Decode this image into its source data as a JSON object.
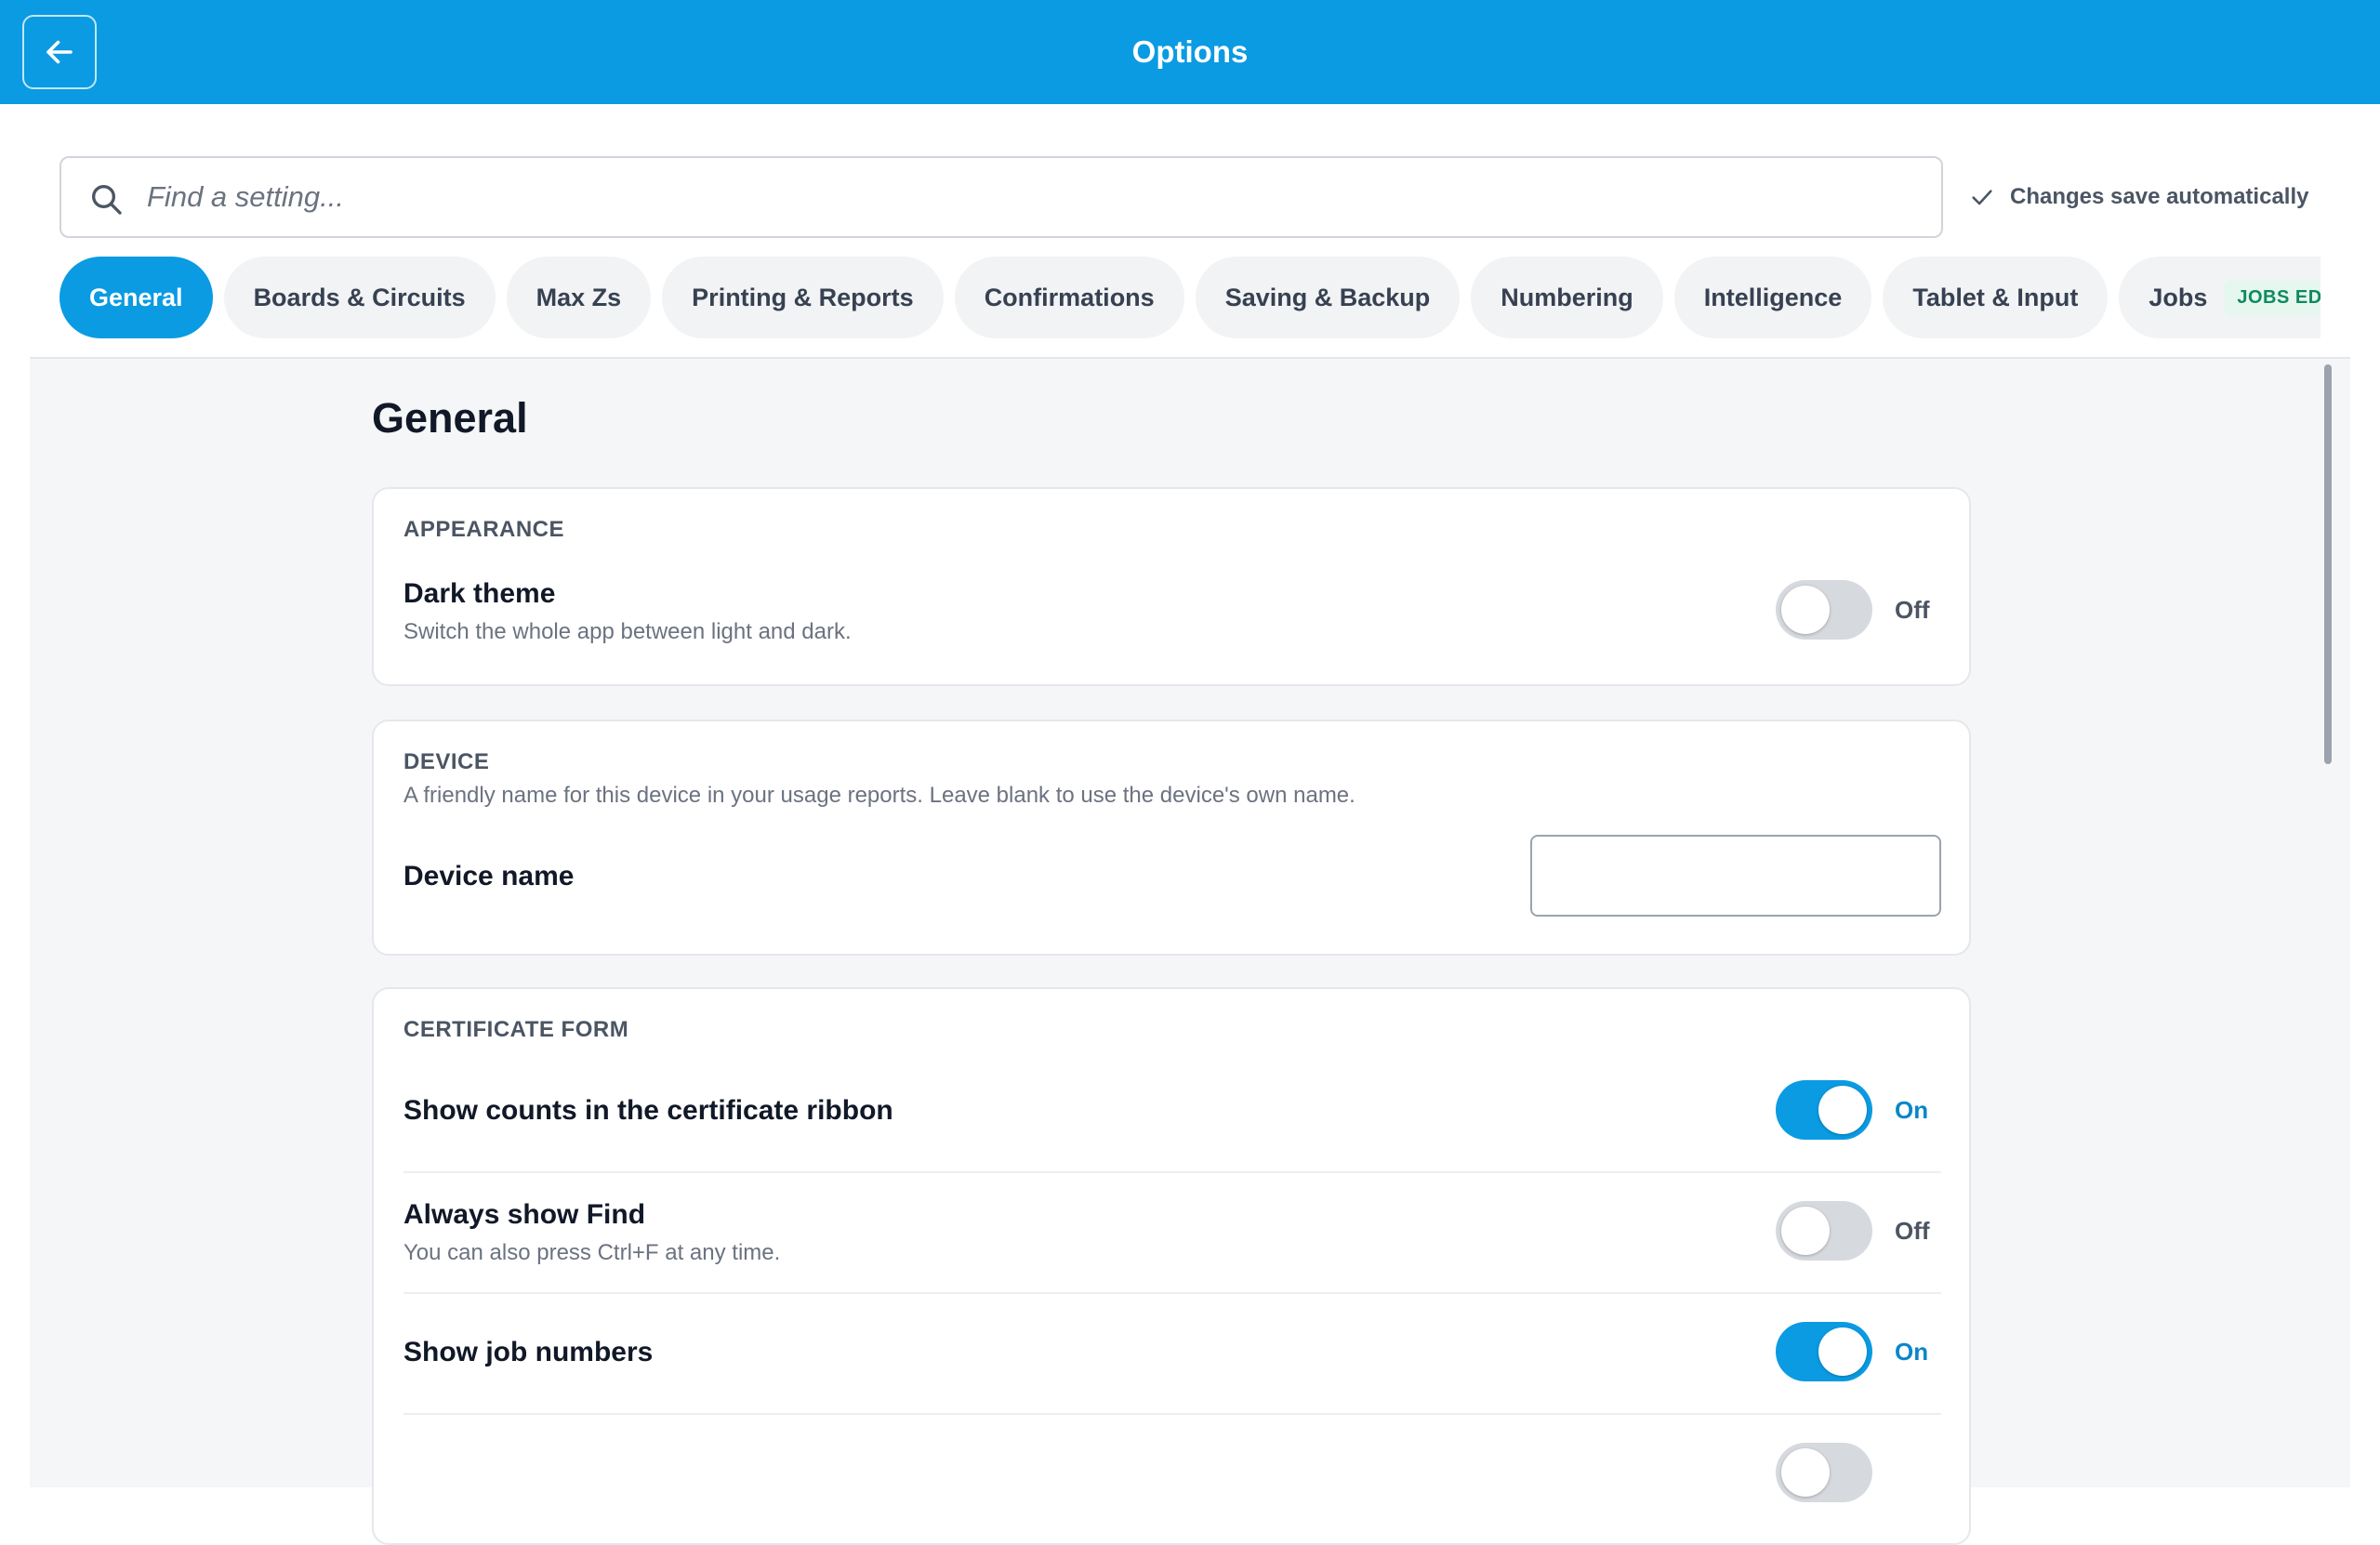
{
  "header": {
    "title": "Options",
    "back_icon": "arrow-left-icon"
  },
  "search": {
    "placeholder": "Find a setting...",
    "value": "",
    "icon": "search-icon"
  },
  "autosave": {
    "label": "Changes save automatically",
    "icon": "check-icon"
  },
  "tabs": [
    {
      "label": "General",
      "active": true
    },
    {
      "label": "Boards & Circuits"
    },
    {
      "label": "Max Zs"
    },
    {
      "label": "Printing & Reports"
    },
    {
      "label": "Confirmations"
    },
    {
      "label": "Saving & Backup"
    },
    {
      "label": "Numbering"
    },
    {
      "label": "Intelligence"
    },
    {
      "label": "Tablet & Input"
    },
    {
      "label": "Jobs",
      "badge": "JOBS EDITION"
    }
  ],
  "page": {
    "title": "General"
  },
  "appearance": {
    "section": "APPEARANCE",
    "dark_theme": {
      "title": "Dark theme",
      "desc": "Switch the whole app between light and dark.",
      "state": "Off",
      "on": false
    }
  },
  "device": {
    "section": "DEVICE",
    "desc": "A friendly name for this device in your usage reports. Leave blank to use the device's own name.",
    "name_label": "Device name",
    "name_value": ""
  },
  "certificate_form": {
    "section": "CERTIFICATE FORM",
    "settings": [
      {
        "title": "Show counts in the certificate ribbon",
        "state": "On",
        "on": true
      },
      {
        "title": "Always show Find",
        "desc": "You can also press Ctrl+F at any time.",
        "state": "Off",
        "on": false
      },
      {
        "title": "Show job numbers",
        "state": "On",
        "on": true
      }
    ]
  },
  "colors": {
    "accent": "#0a9be2",
    "toggle_off": "#d6d9de",
    "background": "#f5f6f7"
  }
}
